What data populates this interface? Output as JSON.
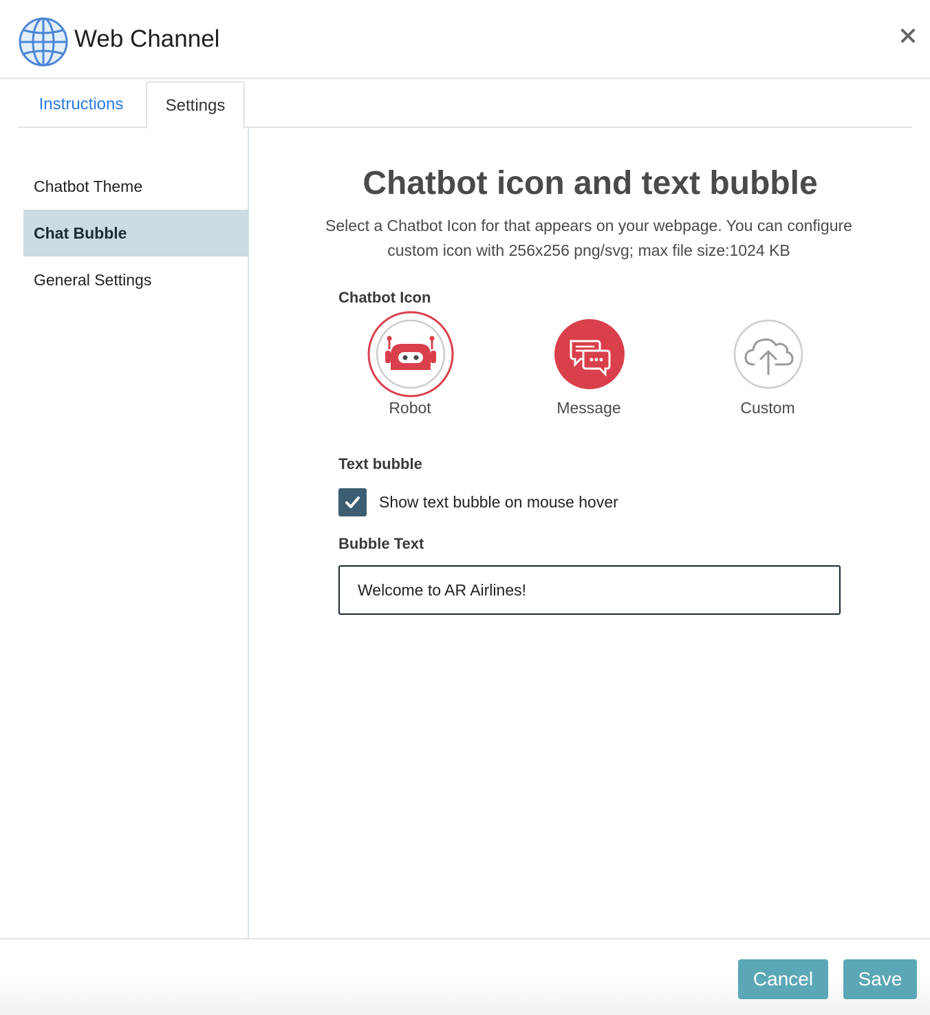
{
  "header": {
    "title": "Web Channel",
    "icon": "globe-icon",
    "close_icon": "close-icon"
  },
  "tabs": [
    {
      "label": "Instructions",
      "active": false
    },
    {
      "label": "Settings",
      "active": true
    }
  ],
  "sidebar": {
    "items": [
      {
        "label": "Chatbot Theme",
        "active": false
      },
      {
        "label": "Chat Bubble",
        "active": true
      },
      {
        "label": "General Settings",
        "active": false
      }
    ]
  },
  "main": {
    "title": "Chatbot icon and text bubble",
    "description": "Select a Chatbot Icon for that appears on your webpage. You can configure custom icon with 256x256 png/svg; max file size:1024 KB",
    "chatbot_icon_label": "Chatbot Icon",
    "icon_options": [
      {
        "label": "Robot",
        "icon": "robot-icon",
        "selected": true
      },
      {
        "label": "Message",
        "icon": "message-icon",
        "selected": false
      },
      {
        "label": "Custom",
        "icon": "cloud-upload-icon",
        "selected": false
      }
    ],
    "text_bubble_label": "Text bubble",
    "show_bubble_label": "Show text bubble on mouse hover",
    "show_bubble_checked": true,
    "bubble_text_label": "Bubble Text",
    "bubble_text_value": "Welcome to AR Airlines!"
  },
  "footer": {
    "cancel_label": "Cancel",
    "save_label": "Save"
  },
  "colors": {
    "accent_red": "#d9404b",
    "tab_blue": "#2a7ae2",
    "button_teal": "#5ba7b6",
    "sidebar_active": "#ccdce1",
    "checkbox": "#3c5d72"
  }
}
